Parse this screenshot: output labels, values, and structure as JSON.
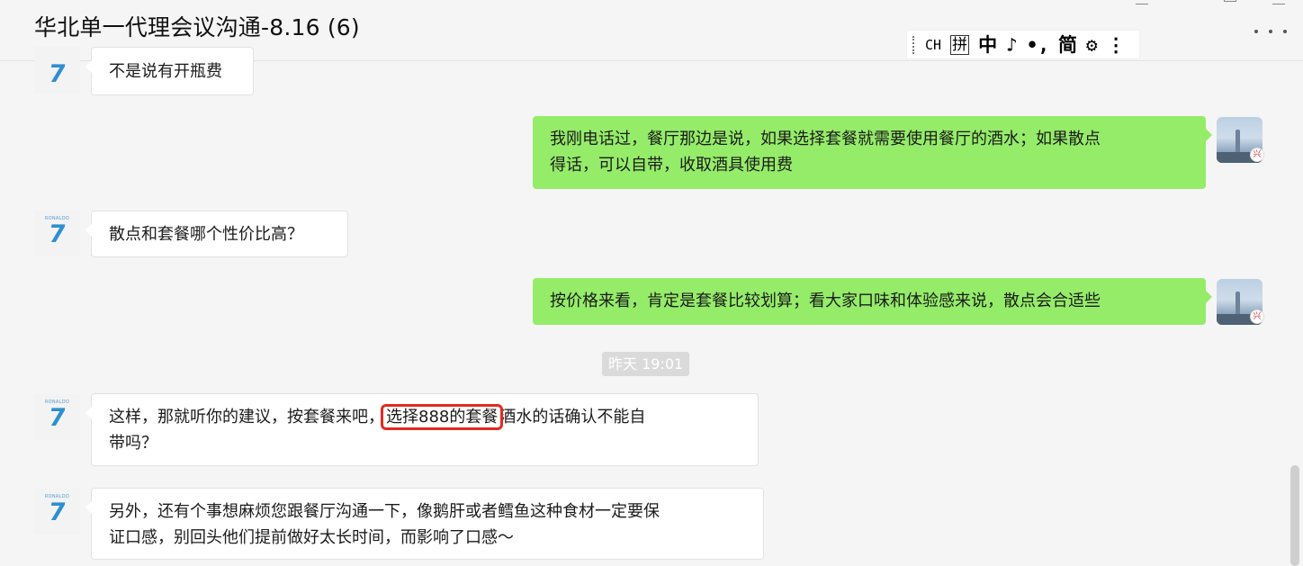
{
  "chat": {
    "title": "华北单一代理会议沟通-8.16 (6)"
  },
  "ime_toolbar": {
    "items": [
      "CH",
      "拼",
      "中",
      "♪",
      "•,",
      "简",
      "⚙",
      "⋮"
    ]
  },
  "avatars": {
    "left_brand": "RONALDO",
    "left_number": "7",
    "right_badge": "兴"
  },
  "messages": [
    {
      "side": "left",
      "text": "不是说有开瓶费"
    },
    {
      "side": "right",
      "line1": "我刚电话过，餐厅那边是说，如果选择套餐就需要使用餐厅的酒水；如果散点",
      "line2": "得话，可以自带，收取酒具使用费"
    },
    {
      "side": "left",
      "text": "散点和套餐哪个性价比高？"
    },
    {
      "side": "right",
      "text": "按价格来看，肯定是套餐比较划算；看大家口味和体验感来说，散点会合适些"
    },
    {
      "side": "left",
      "before": "这样，那就听你的建议，按套餐来吧，",
      "highlight": "选择888的套餐",
      "after": "酒水的话确认不能自",
      "line2": "带吗？"
    },
    {
      "side": "left",
      "line1": "另外，还有个事想麻烦您跟餐厅沟通一下，像鹅肝或者鳕鱼这种食材一定要保",
      "line2": "证口感，别回头他们提前做好太长时间，而影响了口感～"
    }
  ],
  "timestamp": "昨天 19:01",
  "colors": {
    "background": "#f5f5f5",
    "sent_bubble": "#95ec69",
    "received_bubble": "#ffffff",
    "highlight_box": "#e22a22",
    "timestamp_bg": "#dadada"
  }
}
